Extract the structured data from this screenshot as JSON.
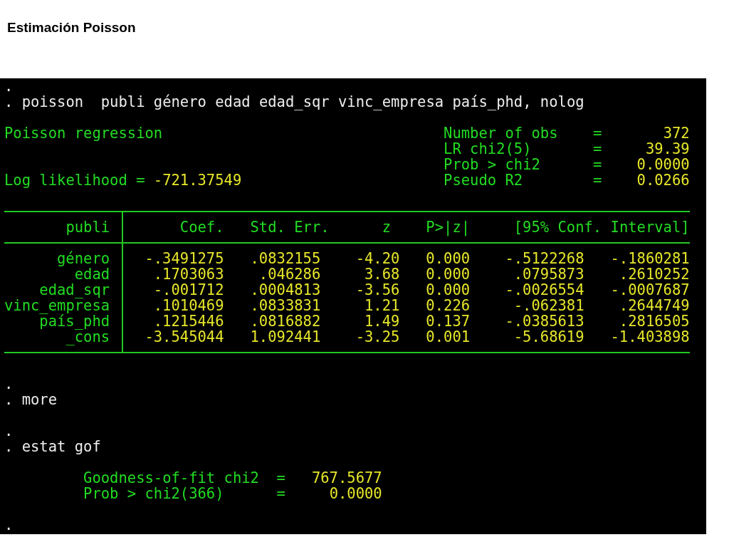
{
  "title": "Estimación Poisson",
  "console": {
    "blocks": [
      {
        "kind": "command",
        "lines": [
          ".",
          ". poisson  publi género edad edad_sqr vinc_empresa país_phd, nolog"
        ]
      },
      {
        "kind": "summary",
        "heading": "Poisson regression",
        "loglik_label": "Log likelihood =",
        "loglik_value": "-721.37549",
        "stats": [
          {
            "label": "Number of obs",
            "sign": "=",
            "value": "372"
          },
          {
            "label": "LR chi2(5)",
            "sign": "=",
            "value": "39.39"
          },
          {
            "label": "Prob > chi2",
            "sign": "=",
            "value": "0.0000"
          },
          {
            "label": "Pseudo R2",
            "sign": "=",
            "value": "0.0266"
          }
        ]
      },
      {
        "kind": "table",
        "columns": [
          "publi",
          "Coef.",
          "Std. Err.",
          "z",
          "P>|z|",
          "[95% Conf. Interval]"
        ],
        "rows": [
          {
            "name": "género",
            "values": [
              "-.3491275",
              ".0832155",
              "-4.20",
              "0.000",
              "-.5122268",
              "-.1860281"
            ]
          },
          {
            "name": "edad",
            "values": [
              ".1703063",
              ".046286",
              "3.68",
              "0.000",
              ".0795873",
              ".2610252"
            ]
          },
          {
            "name": "edad_sqr",
            "values": [
              "-.001712",
              ".0004813",
              "-3.56",
              "0.000",
              "-.0026554",
              "-.0007687"
            ]
          },
          {
            "name": "vinc_empresa",
            "values": [
              ".1010469",
              ".0833831",
              "1.21",
              "0.226",
              "-.062381",
              ".2644749"
            ]
          },
          {
            "name": "país_phd",
            "values": [
              ".1215446",
              ".0816882",
              "1.49",
              "0.137",
              "-.0385613",
              ".2816505"
            ]
          },
          {
            "name": "_cons",
            "values": [
              "-3.545044",
              "1.092441",
              "-3.25",
              "0.001",
              "-5.68619",
              "-1.403898"
            ]
          }
        ]
      },
      {
        "kind": "command",
        "lines": [
          ".",
          ". more"
        ]
      },
      {
        "kind": "command",
        "lines": [
          ".",
          ". estat gof"
        ]
      },
      {
        "kind": "gof",
        "stats": [
          {
            "label": "Goodness-of-fit chi2",
            "sign": "=",
            "value": "767.5677"
          },
          {
            "label": "Prob > chi2(366)",
            "sign": "=",
            "value": "0.0000"
          }
        ]
      },
      {
        "kind": "command",
        "lines": [
          "."
        ]
      }
    ]
  }
}
